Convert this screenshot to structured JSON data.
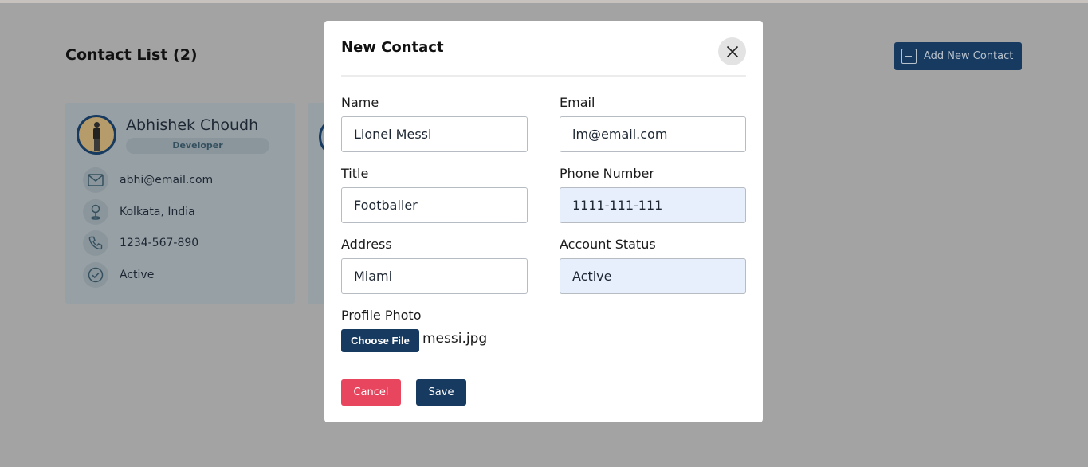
{
  "page": {
    "title": "Contact List (2)",
    "add_button_label": "Add New Contact"
  },
  "contact_card": {
    "name": "Abhishek Choudh",
    "role": "Developer",
    "email": "abhi@email.com",
    "address": "Kolkata, India",
    "phone": "1234-567-890",
    "status": "Active"
  },
  "modal": {
    "title": "New Contact",
    "fields": {
      "name": {
        "label": "Name",
        "value": "Lionel Messi"
      },
      "email": {
        "label": "Email",
        "value": "lm@email.com"
      },
      "title": {
        "label": "Title",
        "value": "Footballer"
      },
      "phone": {
        "label": "Phone Number",
        "value": "1111-111-111"
      },
      "address": {
        "label": "Address",
        "value": "Miami"
      },
      "account_status": {
        "label": "Account Status",
        "value": "Active"
      }
    },
    "profile_photo": {
      "label": "Profile Photo",
      "button_label": "Choose File",
      "file_name": "messi.jpg"
    },
    "cancel_label": "Cancel",
    "save_label": "Save"
  },
  "colors": {
    "primary": "#173a61",
    "danger": "#e8455e",
    "overlay": "#a3a3a3",
    "autofill": "#e8effc"
  },
  "icons": [
    "plus-square-icon",
    "mail-icon",
    "location-pin-icon",
    "phone-icon",
    "check-circle-icon",
    "close-icon"
  ]
}
